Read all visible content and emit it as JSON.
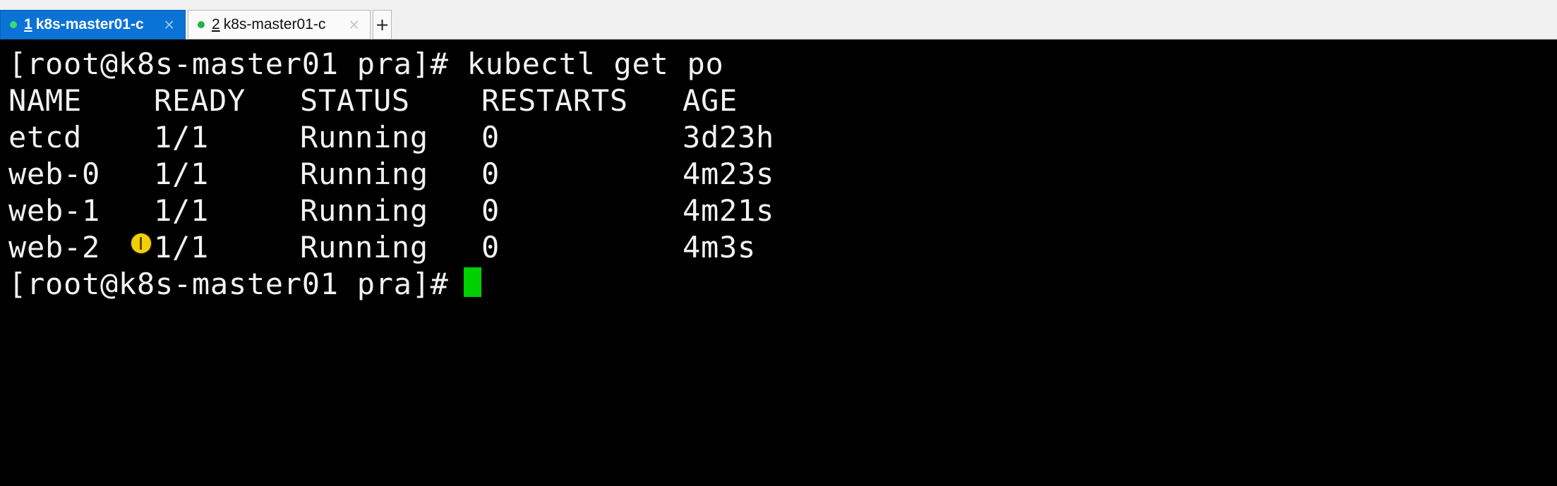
{
  "tabs": [
    {
      "number": "1",
      "title": "k8s-master01-c",
      "active": true,
      "close": "×"
    },
    {
      "number": "2",
      "title": "k8s-master01-c",
      "active": false,
      "close": "×"
    }
  ],
  "new_tab_label": "+",
  "terminal": {
    "command_line": "[root@k8s-master01 pra]# kubectl get po",
    "headers": [
      "NAME",
      "READY",
      "STATUS",
      "RESTARTS",
      "AGE"
    ],
    "rows": [
      [
        "etcd",
        "1/1",
        "Running",
        "0",
        "3d23h"
      ],
      [
        "web-0",
        "1/1",
        "Running",
        "0",
        "4m23s"
      ],
      [
        "web-1",
        "1/1",
        "Running",
        "0",
        "4m21s"
      ],
      [
        "web-2",
        "1/1",
        "Running",
        "0",
        "4m3s"
      ]
    ],
    "prompt": "[root@k8s-master01 pra]# "
  },
  "colors": {
    "active_tab": "#0a73d6",
    "status_dot": "#22b24c",
    "cursor": "#00d000",
    "pointer_highlight": "#f2d000"
  }
}
